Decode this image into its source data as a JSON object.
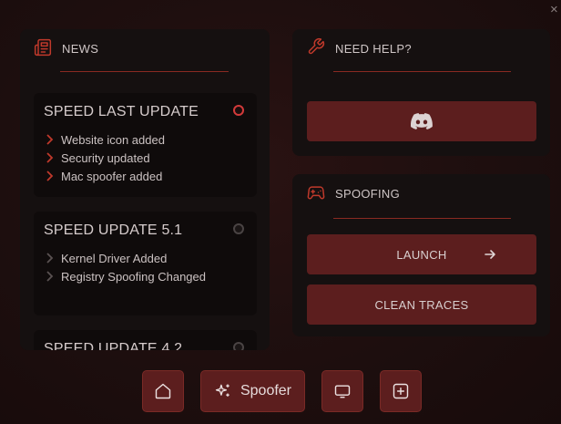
{
  "window": {
    "close_label": "×"
  },
  "news": {
    "title": "NEWS",
    "icon": "newspaper-icon",
    "cards": [
      {
        "title": "SPEED LAST UPDATE",
        "status": "active",
        "items": [
          "Website icon added",
          "Security updated",
          "Mac spoofer added"
        ]
      },
      {
        "title": "SPEED UPDATE 5.1",
        "status": "inactive",
        "items": [
          "Kernel Driver Added",
          "Registry Spoofing Changed"
        ]
      },
      {
        "title": "SPEED UPDATE 4.2",
        "status": "inactive",
        "items": []
      }
    ]
  },
  "help": {
    "title": "NEED HELP?",
    "icon": "wrench-icon",
    "discord_button_icon": "discord-icon"
  },
  "spoofing": {
    "title": "SPOOFING",
    "icon": "gamepad-icon",
    "launch_label": "LAUNCH",
    "clean_label": "CLEAN TRACES"
  },
  "nav": {
    "home_icon": "home-icon",
    "spoofer_label": "Spoofer",
    "spoofer_icon": "sparkles-icon",
    "monitor_icon": "monitor-icon",
    "add_icon": "plus-square-icon"
  },
  "colors": {
    "accent": "#5c1e1e",
    "accent_line": "#8a2a22",
    "active_dot": "#d23a3a",
    "inactive_dot": "#4a4444",
    "chevron_active": "#c0392b",
    "chevron_inactive": "#5a5252"
  }
}
